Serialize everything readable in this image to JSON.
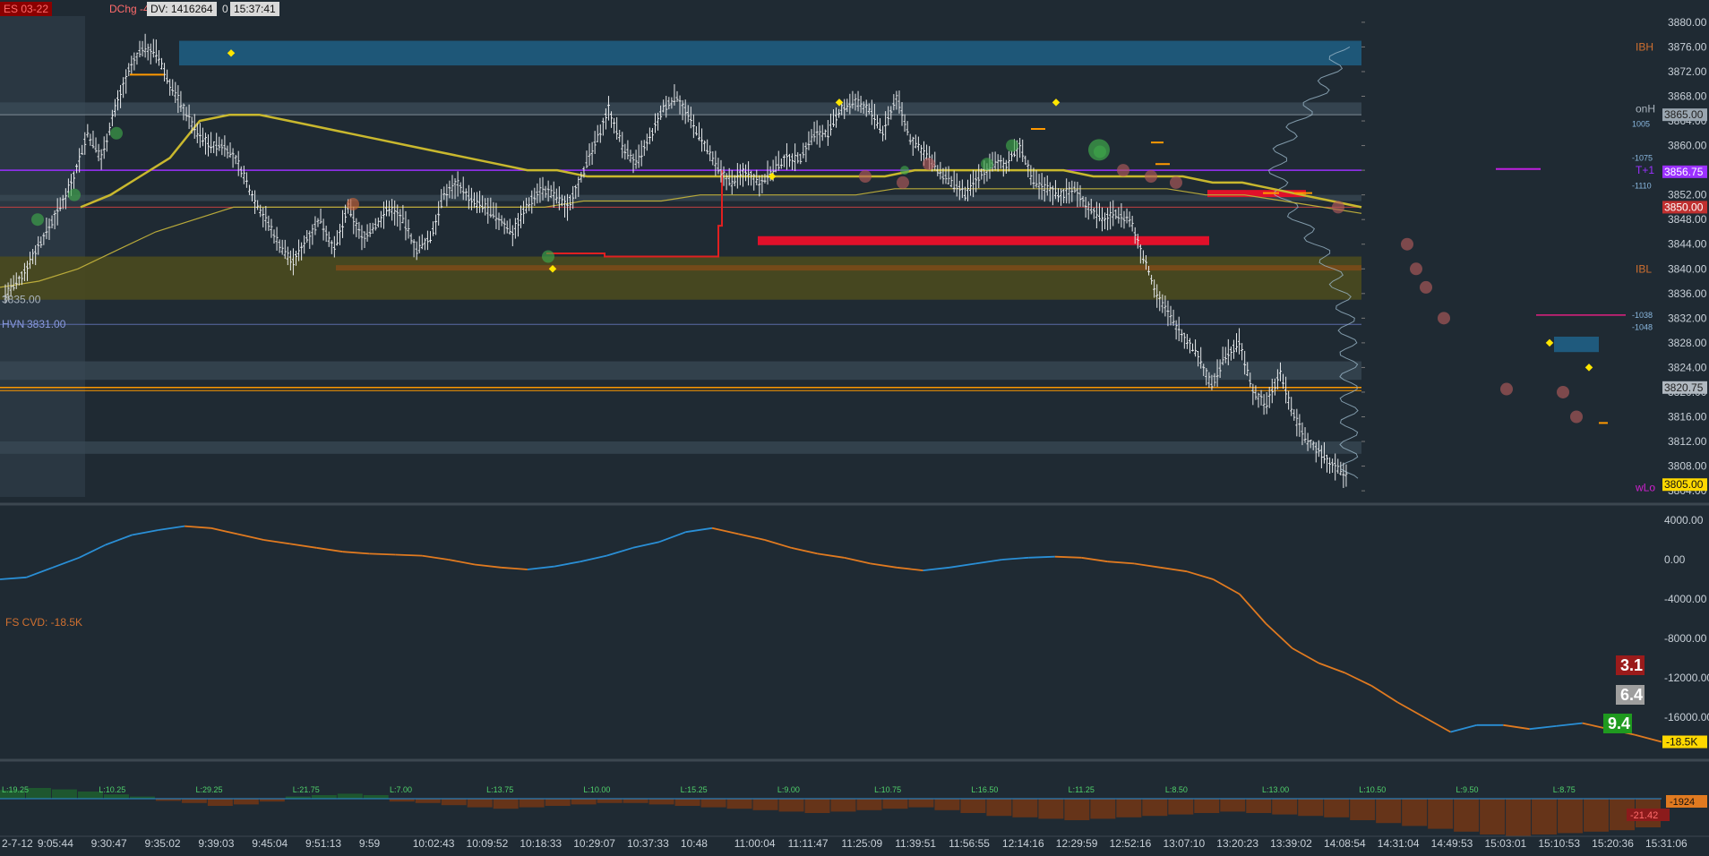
{
  "header": {
    "symbol_badge": "ES 03-22",
    "change_label": "DChg",
    "change_value": "-47.75",
    "dv_label": "DV: 1416264",
    "zero": "0",
    "clock": "15:37:41"
  },
  "colors": {
    "background": "#1f2a33",
    "candle": "#e6e9ec",
    "vwap": "#c9b82e",
    "purple_line": "#9b30ff",
    "orange_line": "#ff9900",
    "red_zone": "#e0102a",
    "blue_zone": "#1f5f85",
    "olive_zone": "#4a4a1e",
    "cvd_blue": "#2a8fd6",
    "cvd_orange": "#e07a20"
  },
  "chart_data": [
    {
      "type": "line",
      "title": "",
      "price_axis": {
        "ylim": [
          3803,
          3881
        ],
        "ticks": [
          "3880.00",
          "3876.00",
          "3872.00",
          "3868.00",
          "3864.00",
          "3860.00",
          "3856.00",
          "3852.00",
          "3848.00",
          "3844.00",
          "3840.00",
          "3836.00",
          "3832.00",
          "3828.00",
          "3824.00",
          "3820.00",
          "3816.00",
          "3812.00",
          "3808.00",
          "3804.00"
        ]
      },
      "time_axis": {
        "ticks": [
          "2-7-12",
          "9:05:44",
          "9:30:47",
          "9:35:02",
          "9:39:03",
          "9:45:04",
          "9:51:13",
          "9:59",
          "10:02:43",
          "10:09:52",
          "10:18:33",
          "10:29:07",
          "10:37:33",
          "10:48",
          "11:00:04",
          "11:11:47",
          "11:25:09",
          "11:39:51",
          "11:56:55",
          "12:14:16",
          "12:29:59",
          "12:52:16",
          "13:07:10",
          "13:20:23",
          "13:39:02",
          "14:08:54",
          "14:31:04",
          "14:49:53",
          "15:03:01",
          "15:10:53",
          "15:20:36",
          "15:31:06"
        ]
      },
      "price_path": [
        3836,
        3838,
        3842,
        3846,
        3850,
        3855,
        3862,
        3858,
        3866,
        3872,
        3876,
        3875,
        3870,
        3866,
        3862,
        3860,
        3860,
        3857,
        3852,
        3848,
        3844,
        3841,
        3845,
        3848,
        3843,
        3850,
        3845,
        3847,
        3850,
        3848,
        3843,
        3845,
        3852,
        3854,
        3851,
        3850,
        3848,
        3846,
        3850,
        3853,
        3852,
        3850,
        3855,
        3860,
        3866,
        3860,
        3857,
        3861,
        3866,
        3868,
        3864,
        3860,
        3856,
        3854,
        3856,
        3854,
        3856,
        3858,
        3858,
        3862,
        3862,
        3866,
        3867,
        3866,
        3862,
        3868,
        3861,
        3859,
        3856,
        3854,
        3852,
        3855,
        3857,
        3857,
        3860,
        3854,
        3853,
        3852,
        3853,
        3850,
        3848,
        3849,
        3848,
        3842,
        3836,
        3832,
        3829,
        3826,
        3821,
        3826,
        3828,
        3820,
        3818,
        3823,
        3816,
        3812,
        3810,
        3808,
        3806
      ],
      "vwap_path": [
        3850,
        3852,
        3855,
        3858,
        3864,
        3865,
        3865,
        3864,
        3863,
        3862,
        3861,
        3860,
        3859,
        3858,
        3857,
        3856,
        3856,
        3855,
        3855,
        3855,
        3855,
        3855,
        3855,
        3855,
        3855,
        3855,
        3855,
        3855,
        3856,
        3856,
        3856,
        3856,
        3856,
        3856,
        3855,
        3855,
        3855,
        3855,
        3854,
        3854,
        3853,
        3852,
        3851,
        3850
      ],
      "lower_avg_path": [
        3837,
        3838,
        3840,
        3843,
        3846,
        3848,
        3850,
        3850,
        3850,
        3850,
        3850,
        3850,
        3850,
        3850,
        3850,
        3851,
        3851,
        3851,
        3852,
        3852,
        3852,
        3852,
        3852,
        3853,
        3853,
        3853,
        3853,
        3853,
        3853,
        3853,
        3853,
        3852,
        3852,
        3851,
        3850,
        3849
      ],
      "annotations": [
        {
          "label": "IBH",
          "price": 3876.0
        },
        {
          "label": "onH",
          "price": 3866.0
        },
        {
          "label": "3865.00",
          "price": 3865.0
        },
        {
          "label": "T+1",
          "price": 3856.0
        },
        {
          "label": "3856.75",
          "price": 3855.75
        },
        {
          "label": "3850.00",
          "price": 3850.0
        },
        {
          "label": "IBL",
          "price": 3840.0
        },
        {
          "label": "HVN",
          "price": 3831.0
        },
        {
          "label": "3831.00",
          "price": 3831.0
        },
        {
          "label": "3820.75",
          "price": 3820.75
        },
        {
          "label": "wLo",
          "price": 3804.5
        },
        {
          "label": "3805.00",
          "price": 3805.0
        },
        {
          "label": "3835.00",
          "price": 3835.0
        }
      ],
      "profile_labels": [
        {
          "label": "1005",
          "price": 3863.5
        },
        {
          "label": "-1075",
          "price": 3858.0
        },
        {
          "label": "-1110",
          "price": 3853.5
        },
        {
          "label": "-1038",
          "price": 3832.5
        },
        {
          "label": "-1048",
          "price": 3830.5
        }
      ],
      "zones": [
        {
          "name": "opening-range-shade",
          "price_from": 3803,
          "price_to": 3881
        },
        {
          "name": "ibh-band",
          "price_from": 3873,
          "price_to": 3877
        },
        {
          "name": "onh-band",
          "price_from": 3865,
          "price_to": 3867
        },
        {
          "name": "upper-band",
          "price_from": 3851,
          "price_to": 3852
        },
        {
          "name": "olive-band",
          "price_from": 3835,
          "price_to": 3842
        },
        {
          "name": "mid-band",
          "price_from": 3822,
          "price_to": 3825
        },
        {
          "name": "low-band",
          "price_from": 3810,
          "price_to": 3812
        }
      ]
    },
    {
      "type": "line",
      "title": "FS CVD: -18.5K",
      "ylim": [
        -20000,
        5000
      ],
      "ticks": [
        "4000.00",
        "0.00",
        "-4000.00",
        "-8000.00",
        "-12000.00",
        "-16000.00"
      ],
      "current": "-18.5K",
      "path": [
        -2000,
        -1800,
        -800,
        200,
        1500,
        2500,
        3000,
        3400,
        3200,
        2600,
        2000,
        1600,
        1200,
        800,
        600,
        500,
        400,
        0,
        -500,
        -800,
        -1000,
        -700,
        -200,
        400,
        1200,
        1800,
        2800,
        3200,
        2600,
        2000,
        1200,
        600,
        200,
        -400,
        -800,
        -1100,
        -800,
        -400,
        0,
        200,
        300,
        200,
        -200,
        -400,
        -800,
        -1200,
        -2000,
        -3500,
        -6500,
        -9000,
        -10500,
        -11500,
        -12800,
        -14500,
        -16000,
        -17500,
        -16800,
        -16800,
        -17200,
        -16900,
        -16600,
        -17200,
        -17800,
        -18500
      ],
      "badges": [
        {
          "value": "3.1",
          "color": "#9b1b1b"
        },
        {
          "value": "6.4",
          "color": "#9e9e9e"
        },
        {
          "value": "9.4",
          "color": "#1f9a1f"
        }
      ]
    },
    {
      "type": "bar",
      "title": "",
      "current": "-1924",
      "marker": "-21.42",
      "bars": [
        12,
        15,
        13,
        10,
        6,
        3,
        -3,
        -6,
        -10,
        -8,
        -4,
        3,
        5,
        7,
        5,
        -4,
        -6,
        -9,
        -12,
        -14,
        -12,
        -10,
        -8,
        -6,
        -6,
        -8,
        -10,
        -12,
        -14,
        -16,
        -18,
        -20,
        -18,
        -16,
        -14,
        -12,
        -16,
        -20,
        -24,
        -26,
        -28,
        -30,
        -28,
        -26,
        -24,
        -22,
        -20,
        -18,
        -20,
        -22,
        -24,
        -26,
        -30,
        -34,
        -38,
        -42,
        -46,
        -50,
        -52,
        -50,
        -48,
        -46,
        -44,
        -40
      ],
      "labels": [
        "L:19.25",
        "L:10.25",
        "L:29.25",
        "L:21.75",
        "L:7.00",
        "L:13.75",
        "L:10.00",
        "L:15.25",
        "L:9.00",
        "L:10.75",
        "L:16.50",
        "L:11.25",
        "L:8.50",
        "L:13.00",
        "L:10.50",
        "L:9.50",
        "L:8.75"
      ]
    }
  ]
}
